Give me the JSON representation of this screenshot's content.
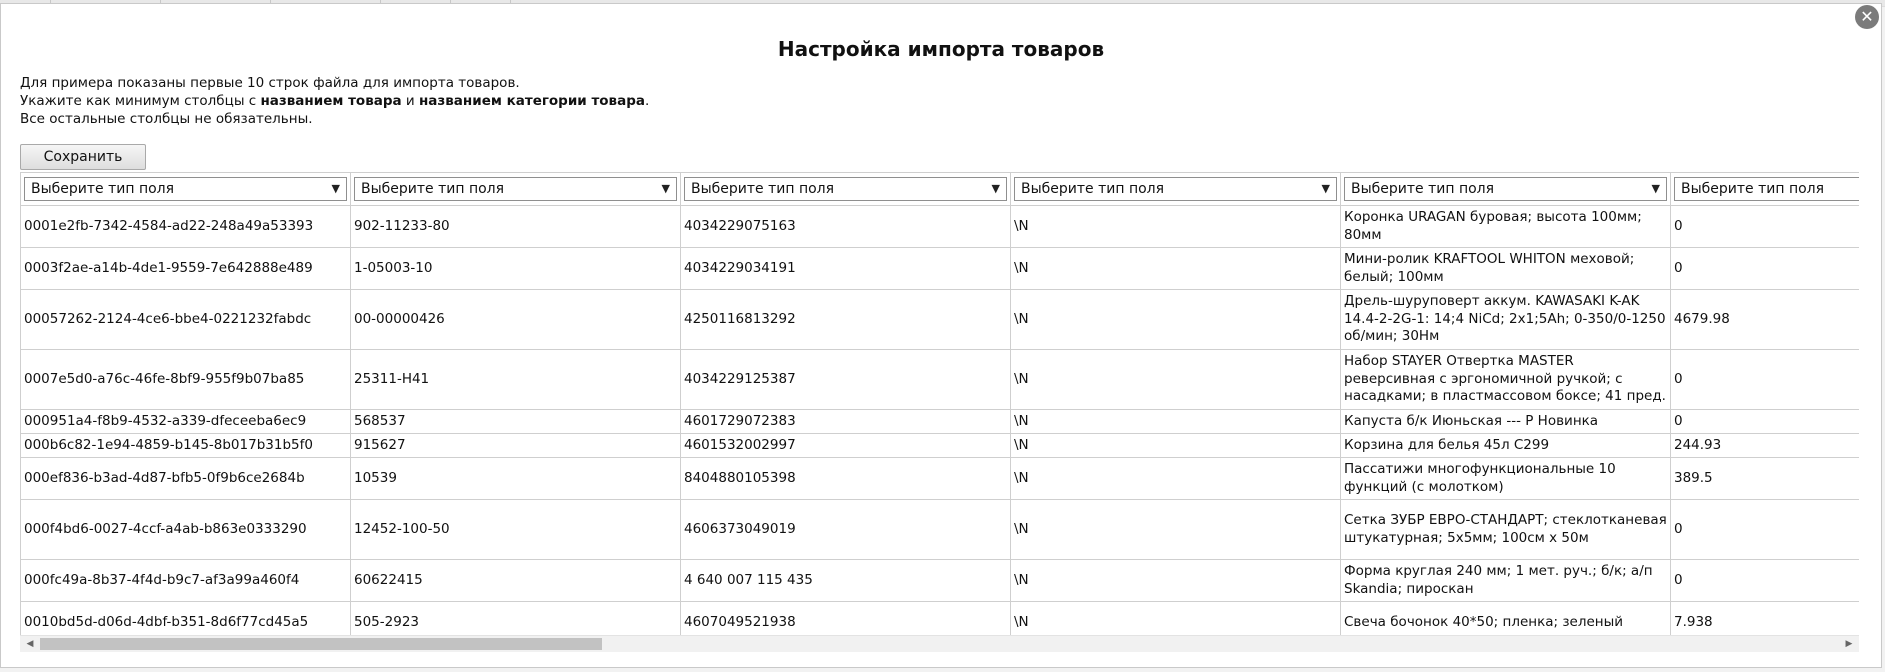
{
  "dialog": {
    "title": "Настройка импорта товаров",
    "intro_line1": "Для примера показаны первые 10 строк файла для импорта товаров.",
    "intro_line2_a": "Укажите как минимум столбцы с ",
    "intro_line2_b": "названием товара",
    "intro_line2_c": " и ",
    "intro_line2_d": "названием категории товара",
    "intro_line2_e": ".",
    "intro_line3": "Все остальные столбцы не обязательны.",
    "save_label": "Сохранить",
    "close_glyph": "✕"
  },
  "table": {
    "field_select_label": "Выберите тип поля",
    "rows": [
      [
        "0001e2fb-7342-4584-ad22-248a49a53393",
        "902-11233-80",
        "4034229075163",
        "\\N",
        "Коронка URAGAN буровая; высота 100мм; 80мм",
        "0"
      ],
      [
        "0003f2ae-a14b-4de1-9559-7e642888e489",
        "1-05003-10",
        "4034229034191",
        "\\N",
        "Мини-ролик KRAFTOOL WHITON меховой; белый; 100мм",
        "0"
      ],
      [
        "00057262-2124-4ce6-bbe4-0221232fabdc",
        "00-00000426",
        "4250116813292",
        "\\N",
        "Дрель-шуруповерт аккум. KAWASAKI K-AK 14.4-2-2G-1: 14;4 NiCd; 2x1;5Ah; 0-350/0-1250 об/мин; 30Нм",
        "4679.98"
      ],
      [
        "0007e5d0-a76c-46fe-8bf9-955f9b07ba85",
        "25311-H41",
        "4034229125387",
        "\\N",
        "Набор STAYER Отвертка MASTER реверсивная с эргономичной ручкой; с насадками; в пластмассовом боксе; 41 пред.",
        "0"
      ],
      [
        "000951a4-f8b9-4532-a339-dfeceeba6ec9",
        "568537",
        "4601729072383",
        "\\N",
        "Капуста б/к Июньская --- Р Новинка",
        "0"
      ],
      [
        "000b6c82-1e94-4859-b145-8b017b31b5f0",
        "915627",
        "4601532002997",
        "\\N",
        "Корзина для белья 45л С299",
        "244.93"
      ],
      [
        "000ef836-b3ad-4d87-bfb5-0f9b6ce2684b",
        "10539",
        "8404880105398",
        "\\N",
        "Пассатижи многофункциональные 10 функций (с молотком)",
        "389.5"
      ],
      [
        "000f4bd6-0027-4ccf-a4ab-b863e0333290",
        "12452-100-50",
        "4606373049019",
        "\\N",
        "Сетка ЗУБР ЕВРО-СТАНДАРТ; стеклотканевая штукатурная; 5х5мм; 100см х 50м",
        "0"
      ],
      [
        "000fc49a-8b37-4f4d-b9c7-af3a99a460f4",
        "60622415",
        "4 640 007 115 435",
        "\\N",
        "Форма круглая 240 мм; 1 мет. руч.; б/к; а/п Skandia; пироскан",
        "0"
      ],
      [
        "0010bd5d-d06d-4dbf-b351-8d6f77cd45a5",
        "505-2923",
        "4607049521938",
        "\\N",
        "Свеча бочонок 40*50; пленка; зеленый",
        "7.938"
      ]
    ]
  },
  "scrollbar": {
    "left_arrow": "◀",
    "right_arrow": "▶"
  }
}
